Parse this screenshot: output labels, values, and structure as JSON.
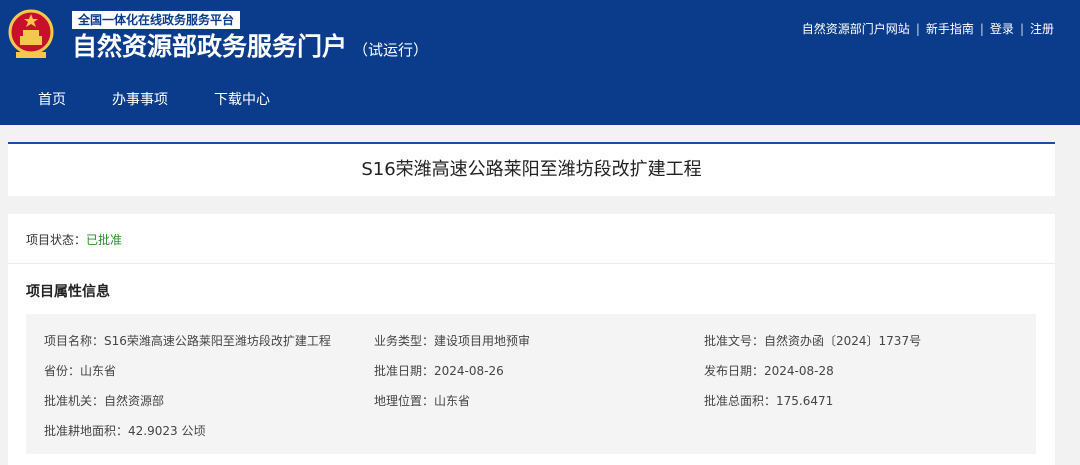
{
  "header": {
    "platform_tag": "全国一体化在线政务服务平台",
    "title": "自然资源部政务服务门户",
    "subtitle": "（试运行）",
    "links": [
      "自然资源部门户网站",
      "新手指南",
      "登录",
      "注册"
    ],
    "nav": [
      "首页",
      "办事事项",
      "下载中心"
    ],
    "colors": {
      "brand": "#0b3c8c",
      "status_green": "#2e8b2e"
    }
  },
  "project": {
    "title": "S16荣潍高速公路莱阳至潍坊段改扩建工程",
    "status_label": "项目状态：",
    "status_value": "已批准",
    "section_title": "项目属性信息",
    "attributes": [
      "项目名称：S16荣潍高速公路莱阳至潍坊段改扩建工程",
      "业务类型：建设项目用地预审",
      "批准文号：自然资办函〔2024〕1737号",
      "省份：山东省",
      "批准日期：2024-08-26",
      "发布日期：2024-08-28",
      "批准机关：自然资源部",
      "地理位置：山东省",
      "批准总面积：175.6471",
      "批准耕地面积：42.9023 公顷"
    ]
  }
}
